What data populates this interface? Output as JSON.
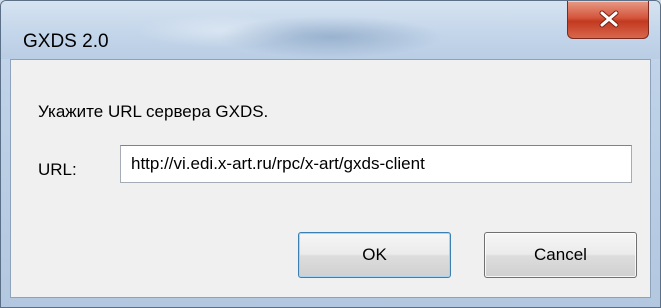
{
  "window": {
    "title": "GXDS 2.0"
  },
  "dialog": {
    "prompt": "Укажите URL сервера GXDS.",
    "url_label": "URL:",
    "url_value": "http://vi.edi.x-art.ru/rpc/x-art/gxds-client"
  },
  "buttons": {
    "ok_label": "OK",
    "cancel_label": "Cancel"
  },
  "icons": {
    "close": "close-icon"
  },
  "colors": {
    "close_button": "#d5563d",
    "title_bar": "#c4d6ea",
    "client_area": "#f0f0f0"
  }
}
